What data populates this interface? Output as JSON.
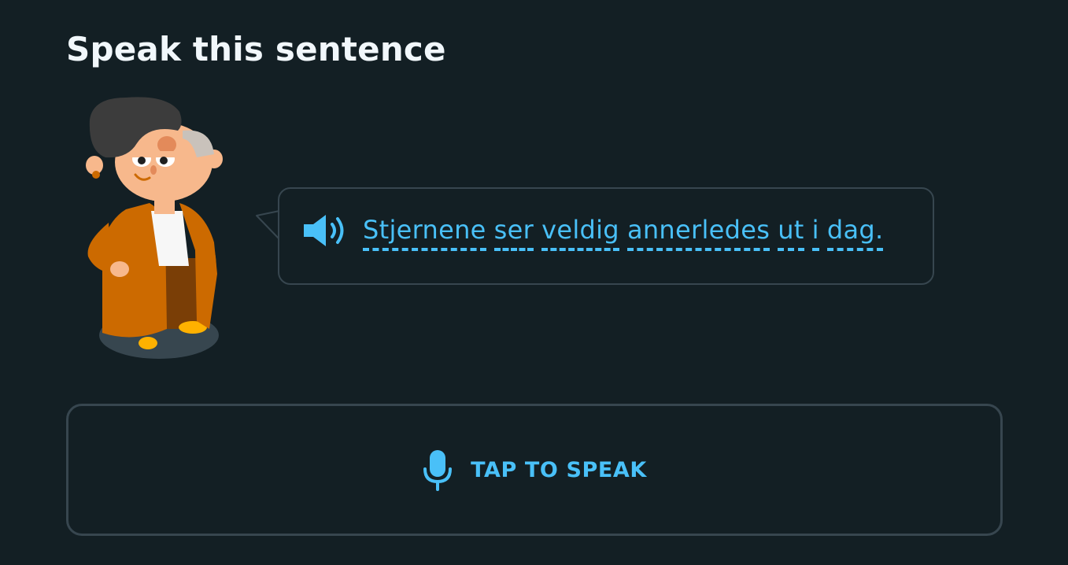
{
  "challenge": {
    "title": "Speak this sentence"
  },
  "prompt": {
    "audio_icon": "speaker-icon",
    "words": [
      "Stjernene",
      "ser",
      "veldig",
      "annerledes",
      "ut",
      "i",
      "dag."
    ]
  },
  "speak_button": {
    "label": "TAP TO SPEAK",
    "icon": "microphone-icon"
  },
  "colors": {
    "background": "#131f24",
    "border": "#37464f",
    "accent": "#49c0f8",
    "title_text": "#f1f7fb"
  }
}
